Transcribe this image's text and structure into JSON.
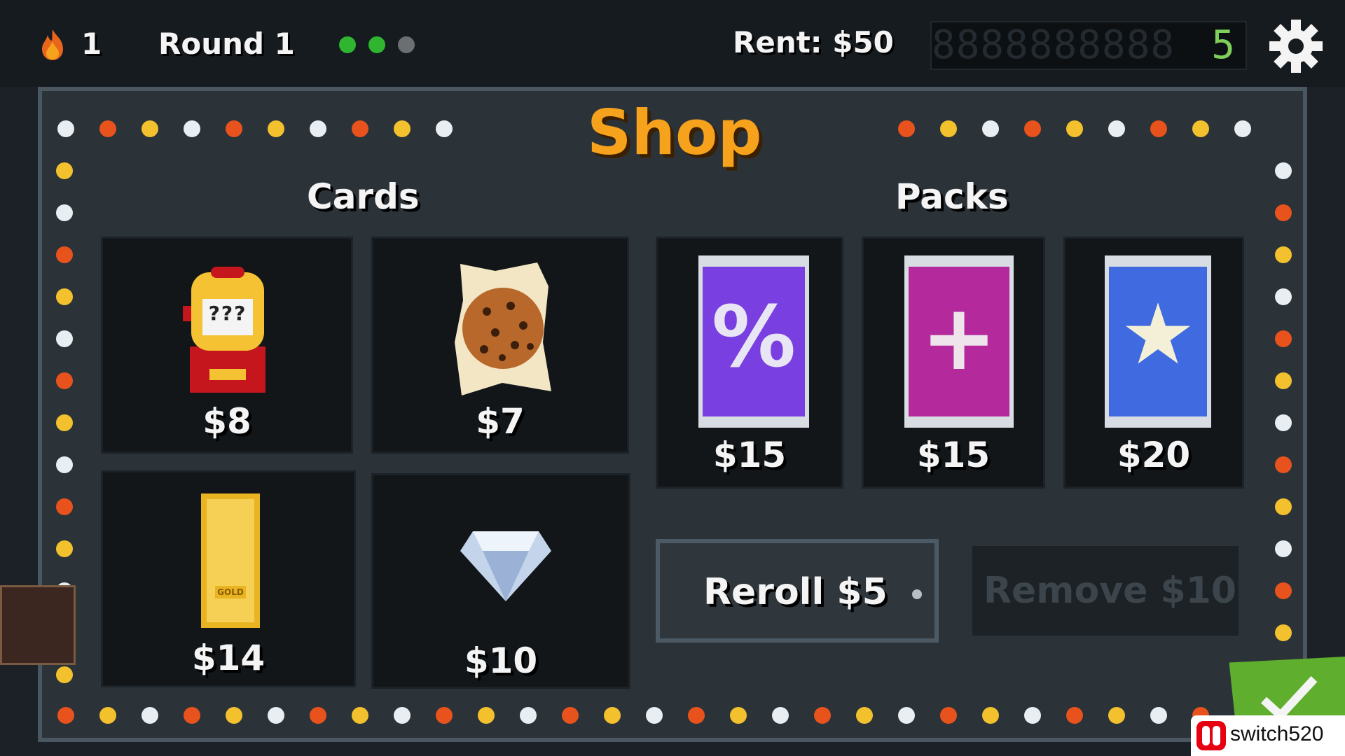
{
  "hud": {
    "flame_count": "1",
    "round_label": "Round 1",
    "round_dots": [
      "done",
      "done",
      "pending"
    ],
    "rent_label": "Rent: $50",
    "counter_ghost": "8888888888",
    "counter_value": "5"
  },
  "shop": {
    "title": "Shop",
    "cards_heading": "Cards",
    "packs_heading": "Packs",
    "cards": [
      {
        "item": "slot-machine",
        "price": "$8",
        "art_text": "???"
      },
      {
        "item": "cookie",
        "price": "$7"
      },
      {
        "item": "gold-bar",
        "price": "$14",
        "art_text": "GOLD"
      },
      {
        "item": "diamond",
        "price": "$10"
      }
    ],
    "packs": [
      {
        "item": "percent-pack",
        "price": "$15",
        "symbol": "%"
      },
      {
        "item": "plus-pack",
        "price": "$15",
        "symbol": "+"
      },
      {
        "item": "star-pack",
        "price": "$20",
        "symbol": "★"
      }
    ],
    "reroll_label": "Reroll $5",
    "remove_label": "Remove $10"
  },
  "watermark": {
    "text": "switch520"
  },
  "colors": {
    "accent_orange": "#f6a21c",
    "dot_done": "#2fb52f",
    "dot_pending": "#6b6f72",
    "bulb_white": "#e8eef2",
    "bulb_orange": "#e8521c",
    "bulb_yellow": "#f3c12e",
    "confirm_green": "#5fae2e",
    "nintendo_red": "#e60012"
  }
}
